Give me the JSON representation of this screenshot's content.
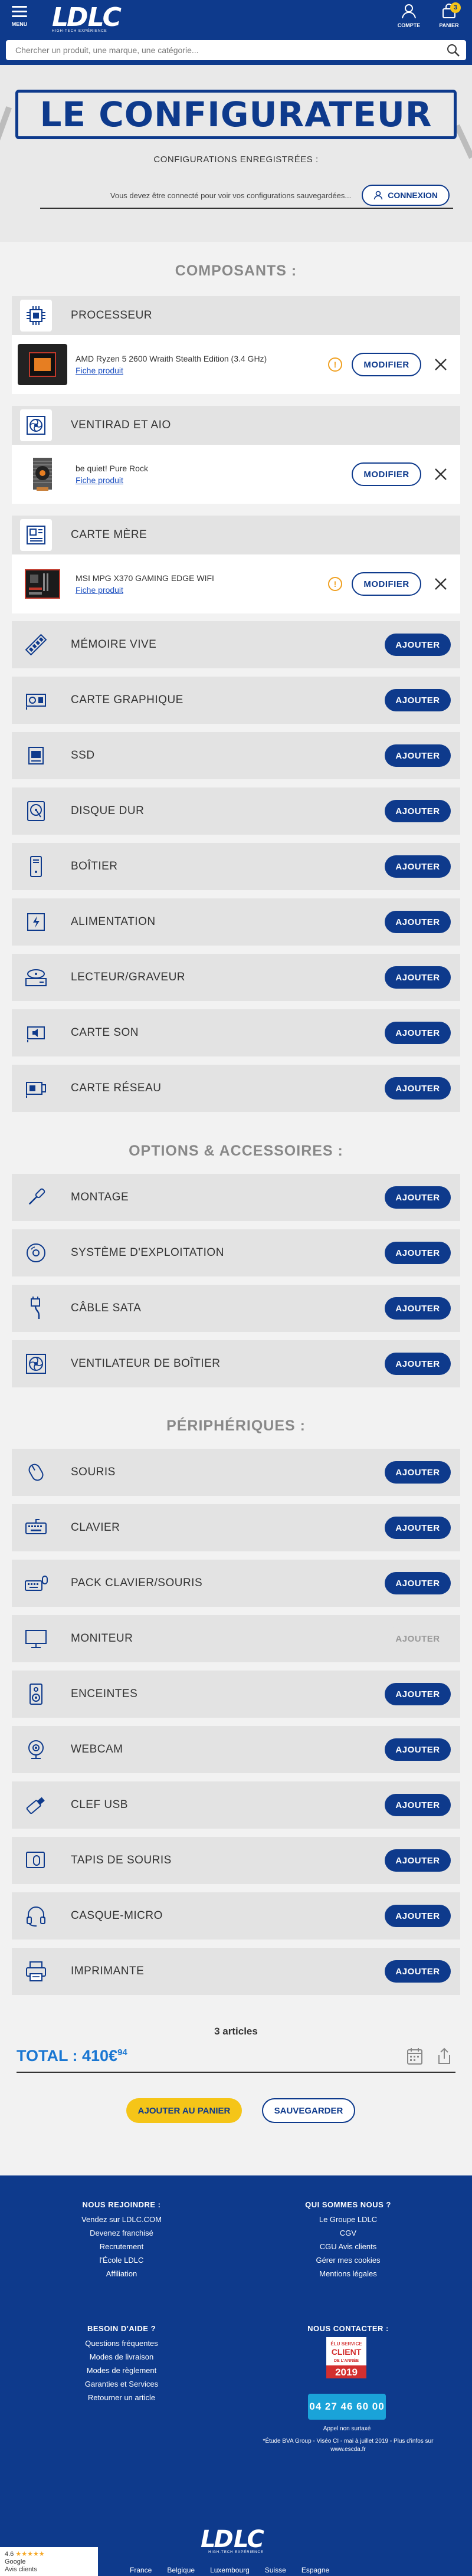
{
  "header": {
    "menu_label": "MENU",
    "logo_text_1": "LD",
    "logo_text_2": "LC",
    "logo_tagline": "HIGH-TECH EXPÉRIENCE",
    "account_label": "COMPTE",
    "cart_label": "PANIER",
    "cart_count": "3"
  },
  "search": {
    "placeholder": "Chercher un produit, une marque, une catégorie..."
  },
  "hero": {
    "title": "LE CONFIGURATEUR"
  },
  "saved": {
    "title": "CONFIGURATIONS ENREGISTRÉES :",
    "message": "Vous devez être connecté pour voir vos configurations sauvegardées...",
    "login_label": "CONNEXION"
  },
  "sections": {
    "components": "COMPOSANTS :",
    "options": "OPTIONS & ACCESSOIRES :",
    "peripherals": "PÉRIPHÉRIQUES :"
  },
  "buttons": {
    "add": "AJOUTER",
    "modify": "MODIFIER"
  },
  "selected": [
    {
      "category": "PROCESSEUR",
      "icon": "cpu-icon",
      "product": "AMD Ryzen 5 2600 Wraith Stealth Edition (3.4 GHz)",
      "link": "Fiche produit",
      "warning": "!"
    },
    {
      "category": "VENTIRAD ET AIO",
      "icon": "cooler-icon",
      "product": "be quiet! Pure Rock",
      "link": "Fiche produit",
      "warning": ""
    },
    {
      "category": "CARTE MÈRE",
      "icon": "motherboard-icon",
      "product": "MSI MPG X370 GAMING EDGE WIFI",
      "link": "Fiche produit",
      "warning": "!"
    }
  ],
  "components": [
    {
      "label": "MÉMOIRE VIVE",
      "icon": "ram-icon"
    },
    {
      "label": "CARTE GRAPHIQUE",
      "icon": "gpu-icon"
    },
    {
      "label": "SSD",
      "icon": "ssd-icon"
    },
    {
      "label": "DISQUE DUR",
      "icon": "hdd-icon"
    },
    {
      "label": "BOÎTIER",
      "icon": "case-icon"
    },
    {
      "label": "ALIMENTATION",
      "icon": "psu-icon"
    },
    {
      "label": "LECTEUR/GRAVEUR",
      "icon": "optical-drive-icon"
    },
    {
      "label": "CARTE SON",
      "icon": "sound-card-icon"
    },
    {
      "label": "CARTE RÉSEAU",
      "icon": "network-card-icon"
    }
  ],
  "options": [
    {
      "label": "MONTAGE",
      "icon": "screwdriver-icon"
    },
    {
      "label": "SYSTÈME D'EXPLOITATION",
      "icon": "disc-icon"
    },
    {
      "label": "CÂBLE SATA",
      "icon": "sata-cable-icon"
    },
    {
      "label": "VENTILATEUR DE BOÎTIER",
      "icon": "fan-icon"
    }
  ],
  "peripherals": [
    {
      "label": "SOURIS",
      "icon": "mouse-icon",
      "disabled": false
    },
    {
      "label": "CLAVIER",
      "icon": "keyboard-icon",
      "disabled": false
    },
    {
      "label": "PACK CLAVIER/SOURIS",
      "icon": "keyboard-mouse-icon",
      "disabled": false
    },
    {
      "label": "MONITEUR",
      "icon": "monitor-icon",
      "disabled": true
    },
    {
      "label": "ENCEINTES",
      "icon": "speaker-icon",
      "disabled": false
    },
    {
      "label": "WEBCAM",
      "icon": "webcam-icon",
      "disabled": false
    },
    {
      "label": "CLEF USB",
      "icon": "usb-key-icon",
      "disabled": false
    },
    {
      "label": "TAPIS DE SOURIS",
      "icon": "mousepad-icon",
      "disabled": false
    },
    {
      "label": "CASQUE-MICRO",
      "icon": "headset-icon",
      "disabled": false
    },
    {
      "label": "IMPRIMANTE",
      "icon": "printer-icon",
      "disabled": false
    }
  ],
  "summary": {
    "count": "3 articles",
    "total_label": "TOTAL : ",
    "total_value": "410€",
    "total_cents": "94",
    "add_to_cart": "AJOUTER AU PANIER",
    "save": "SAUVEGARDER"
  },
  "footer": {
    "join_title": "NOUS REJOINDRE :",
    "join_links": [
      "Vendez sur LDLC.COM",
      "Devenez franchisé",
      "Recrutement",
      "l'École LDLC",
      "Affiliation"
    ],
    "who_title": "QUI SOMMES NOUS ?",
    "who_links": [
      "Le Groupe LDLC",
      "CGV",
      "CGU Avis clients",
      "Gérer mes cookies",
      "Mentions légales"
    ],
    "help_title": "BESOIN D'AIDE ?",
    "help_links": [
      "Questions fréquentes",
      "Modes de livraison",
      "Modes de règlement",
      "Garanties et Services",
      "Retourner un article"
    ],
    "contact_title": "NOUS CONTACTER :",
    "badge_text_1": "ÉLU SERVICE",
    "badge_text_2": "CLIENT",
    "badge_text_3": "DE L'ANNÉE",
    "badge_year": "2019",
    "phone": "04 27 46 60 00",
    "phone_note": "Appel non surtaxé",
    "note": "*Étude BVA Group - Viséo CI - mai à juillet 2019 - Plus d'infos sur www.escda.fr",
    "rating_score": "4.6",
    "rating_stars": "★★★★★",
    "rating_source": "Google",
    "rating_label": "Avis clients",
    "bottom_links": [
      "France",
      "Belgique",
      "Luxembourg",
      "Suisse",
      "Espagne"
    ]
  },
  "colors": {
    "brand": "#0e3a8c",
    "accent_yellow": "#f5c518",
    "total_blue": "#1a77d2",
    "warning": "#f0a020"
  }
}
